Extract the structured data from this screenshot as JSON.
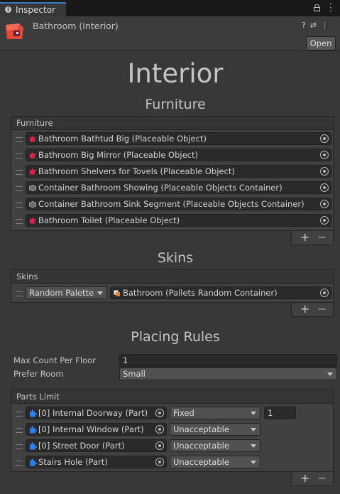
{
  "window": {
    "tab_label": "Inspector"
  },
  "header": {
    "object_name": "Bathroom (Interior)",
    "open_label": "Open"
  },
  "title": "Interior",
  "furniture": {
    "section_title": "Furniture",
    "list_label": "Furniture",
    "items": [
      {
        "label": "Bathroom Bathtud Big (Placeable Object)",
        "icon": "placeable-object-icon"
      },
      {
        "label": "Bathroom Big Mirror (Placeable Object)",
        "icon": "placeable-object-icon"
      },
      {
        "label": "Bathroom Shelvers for Tovels (Placeable Object)",
        "icon": "placeable-object-icon"
      },
      {
        "label": "Container Bathroom Showing (Placeable Objects Container)",
        "icon": "container-icon"
      },
      {
        "label": "Container Bathroom Sink Segment (Placeable Objects Container)",
        "icon": "container-icon"
      },
      {
        "label": "Bathroom Toilet (Placeable Object)",
        "icon": "placeable-object-icon"
      }
    ]
  },
  "skins": {
    "section_title": "Skins",
    "list_label": "Skins",
    "items": [
      {
        "mode": "Random Palette",
        "value": "Bathroom (Pallets Random Container)"
      }
    ]
  },
  "placing_rules": {
    "section_title": "Placing Rules",
    "max_count_label": "Max Count Per Floor",
    "max_count_value": "1",
    "prefer_room_label": "Prefer Room",
    "prefer_room_value": "Small"
  },
  "parts_limit": {
    "list_label": "Parts Limit",
    "items": [
      {
        "part": "[0] Internal Doorway (Part)",
        "rule": "Fixed",
        "count": "1"
      },
      {
        "part": "[0] Internal Window (Part)",
        "rule": "Unacceptable"
      },
      {
        "part": "[0] Street Door (Part)",
        "rule": "Unacceptable"
      },
      {
        "part": "Stairs Hole (Part)",
        "rule": "Unacceptable"
      }
    ]
  },
  "list_controls": {
    "add": "+",
    "remove": "−"
  },
  "colors": {
    "background": "#383838",
    "field": "#2a2a2a",
    "accent": "#3a79bb",
    "placeable_icon": "#d8234f",
    "part_icon": "#2f7fe8"
  }
}
